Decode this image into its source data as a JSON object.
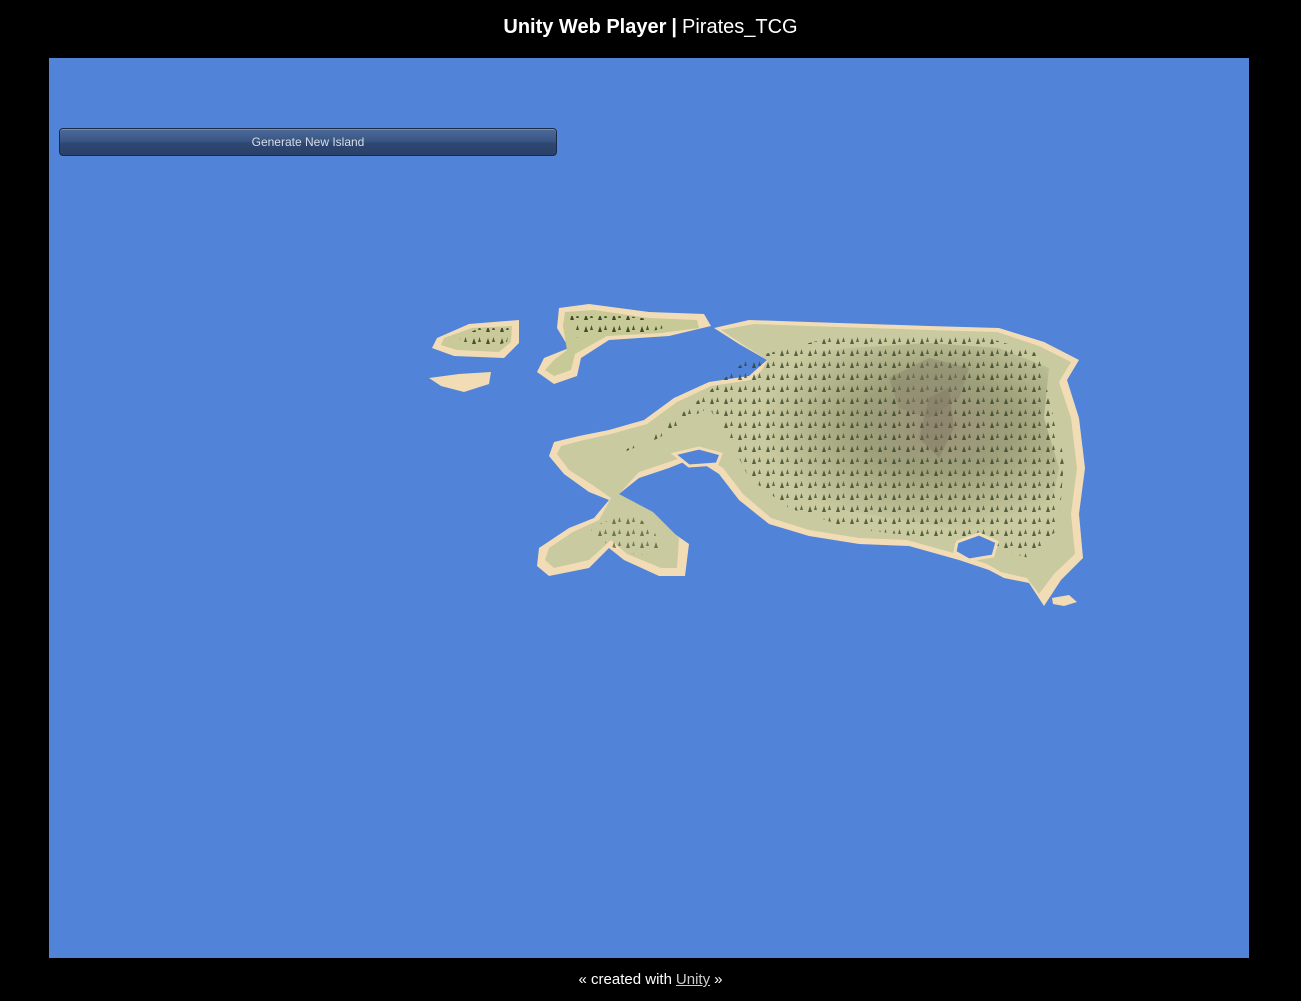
{
  "header": {
    "app_name": "Unity Web Player",
    "separator": "|",
    "game_title": "Pirates_TCG"
  },
  "player": {
    "background_color": "#5183d8",
    "generate_button_label": "Generate New Island"
  },
  "footer": {
    "prefix": "« created with",
    "link_label": "Unity",
    "suffix": "»"
  },
  "colors": {
    "sand": "#f2dcb6",
    "grass": "#c7c996",
    "hill": "#8f8b6c",
    "trees": "#3c4a26"
  }
}
